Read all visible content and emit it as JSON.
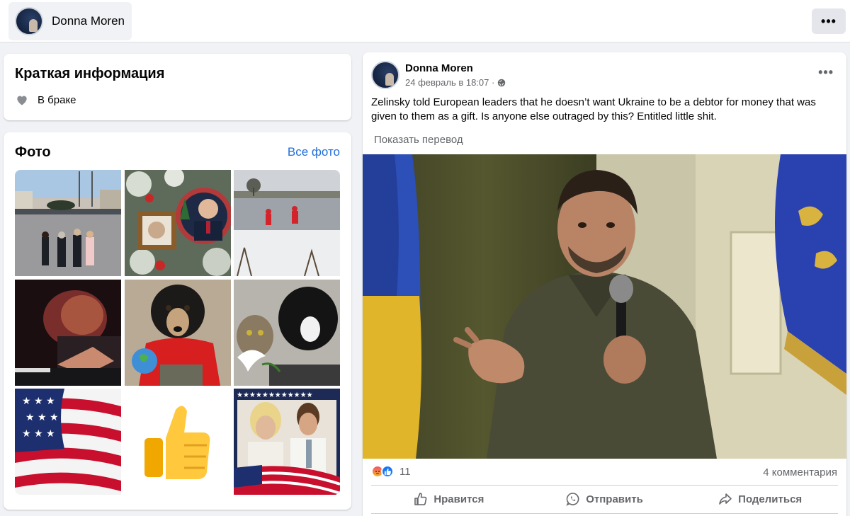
{
  "header": {
    "profile_name": "Donna Moren",
    "more_label": "•••"
  },
  "intro": {
    "title": "Краткая информация",
    "relationship": "В браке"
  },
  "photos": {
    "title": "Фото",
    "see_all": "Все фото",
    "items": [
      {
        "icon": "plaza-helicopter"
      },
      {
        "icon": "christmas-ornament"
      },
      {
        "icon": "snowy-pond"
      },
      {
        "icon": "portrait-shadow"
      },
      {
        "icon": "dog-red-sweater"
      },
      {
        "icon": "cat-dog-dove"
      },
      {
        "icon": "american-flag"
      },
      {
        "icon": "thumbs-up"
      },
      {
        "icon": "couple-flag"
      }
    ]
  },
  "post": {
    "author": "Donna Moren",
    "timestamp": "24 февраль в 18:07 ·",
    "text": "Zelinsky  told European leaders that he doesn’t want Ukraine to be a debtor for money that was given to them as a gift.  Is anyone else outraged by this?   Entitled little shit.",
    "translate": "Показать перевод",
    "image_icon": "man-with-microphone",
    "reaction_count": "11",
    "comments": "4 комментария",
    "actions": {
      "like": "Нравится",
      "send": "Отправить",
      "share": "Поделиться"
    }
  },
  "colors": {
    "link": "#216fdb",
    "secondary_text": "#65676b",
    "like_blue": "#1877f2"
  }
}
